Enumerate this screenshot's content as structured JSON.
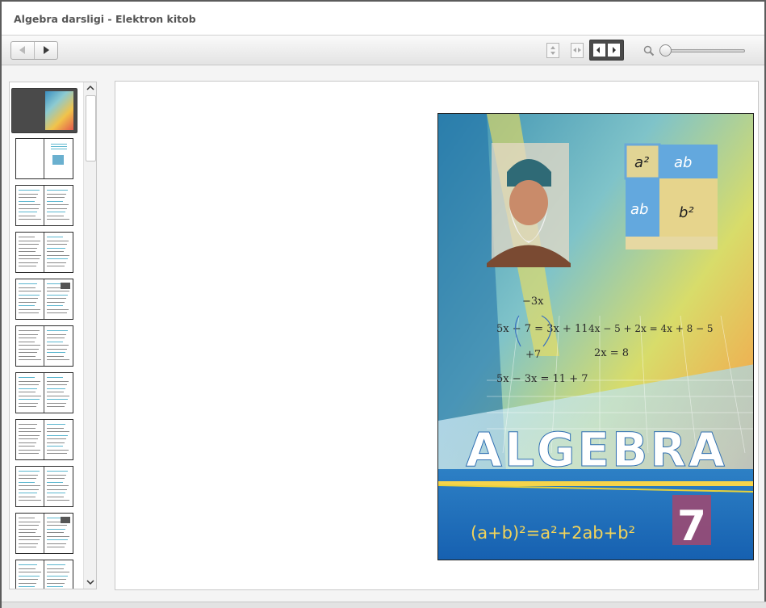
{
  "window": {
    "title": "Algebra darsligi - Elektron kitob"
  },
  "toolbar": {
    "prev_icon": "triangle-left-icon",
    "next_icon": "triangle-right-icon",
    "views": [
      {
        "name": "vertical-scroll-view",
        "icon": "vertical-arrows-icon",
        "active": false
      },
      {
        "name": "single-page-view",
        "icon": "horizontal-arrows-icon",
        "active": false
      },
      {
        "name": "double-page-view",
        "icon": "two-page-icon",
        "active": true
      }
    ],
    "zoom_icon": "magnifier-icon",
    "zoom_level": 0.0
  },
  "thumbnails": {
    "count_visible": 11,
    "selected_index": 0
  },
  "cover": {
    "title": "ALGEBRA",
    "grade": "7",
    "formula": "(a+b)²=a²+2ab+b²",
    "square_labels": [
      "a²",
      "ab",
      "ab",
      "b²"
    ],
    "equations": {
      "top_arrow": "−3x",
      "eq1": "5x − 7 = 3x + 11",
      "bottom_arrow": "+7",
      "eq3": "5x − 3x = 11 + 7",
      "right1": "4x − 5 + 2x = 4x + 8 − 5",
      "right2": "2x = 8"
    }
  },
  "colors": {
    "accent": "#4a4a4a",
    "cover_title": "#ffffff"
  }
}
